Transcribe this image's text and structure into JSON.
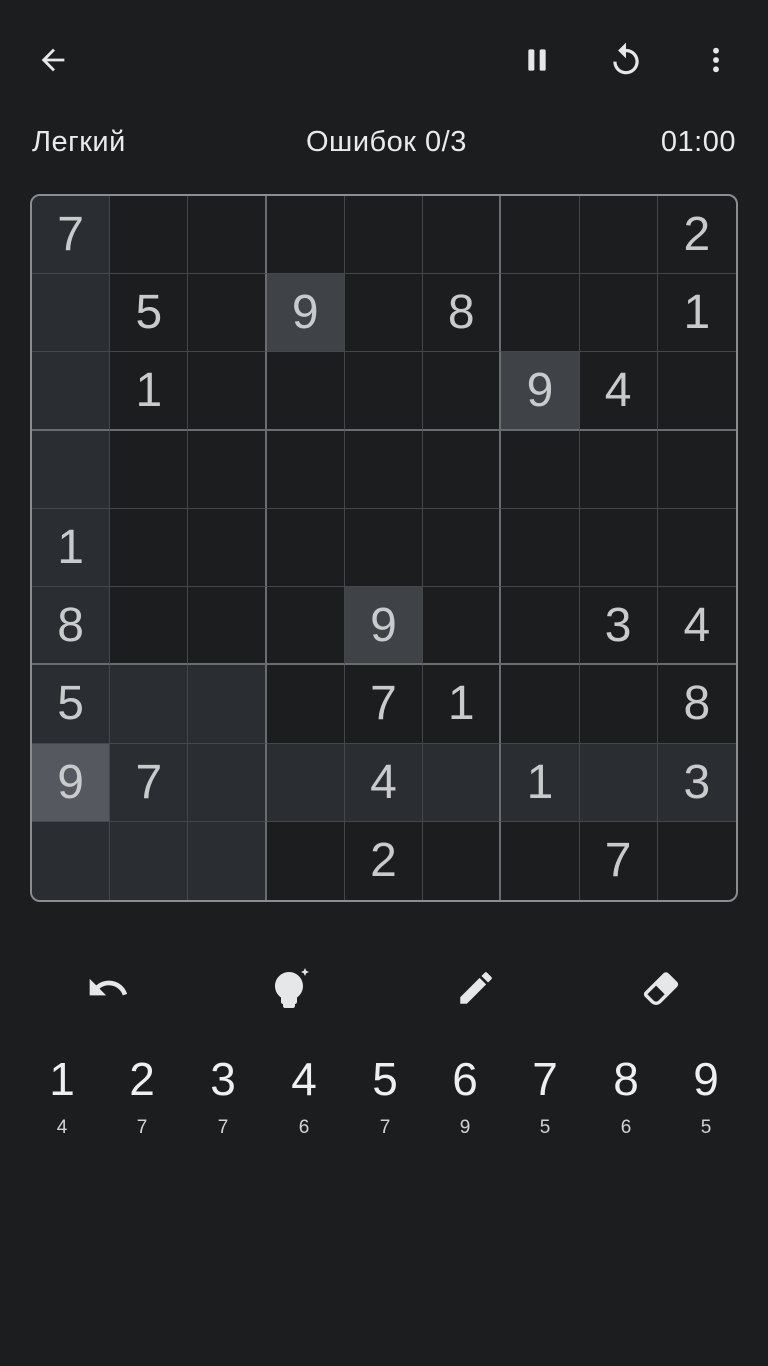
{
  "header": {
    "icons": {
      "back": "arrow-left-icon",
      "pause": "pause-icon",
      "restart": "restart-icon",
      "menu": "more-vertical-icon"
    }
  },
  "status": {
    "difficulty": "Легкий",
    "mistakes": "Ошибок 0/3",
    "timer": "01:00"
  },
  "board": {
    "rows": [
      [
        "7",
        "",
        "",
        "",
        "",
        "",
        "",
        "",
        "2"
      ],
      [
        "",
        "5",
        "",
        "9",
        "",
        "8",
        "",
        "",
        "1"
      ],
      [
        "",
        "1",
        "",
        "",
        "",
        "",
        "9",
        "4",
        ""
      ],
      [
        "",
        "",
        "",
        "",
        "",
        "",
        "",
        "",
        ""
      ],
      [
        "1",
        "",
        "",
        "",
        "",
        "",
        "",
        "",
        ""
      ],
      [
        "8",
        "",
        "",
        "",
        "9",
        "",
        "",
        "3",
        "4"
      ],
      [
        "5",
        "",
        "",
        "",
        "7",
        "1",
        "",
        "",
        "8"
      ],
      [
        "9",
        "7",
        "",
        "",
        "4",
        "",
        "1",
        "",
        "3"
      ],
      [
        "",
        "",
        "",
        "",
        "2",
        "",
        "",
        "7",
        ""
      ]
    ],
    "selected": {
      "row": 7,
      "col": 0
    },
    "same_value_cells": [
      [
        1,
        3
      ],
      [
        2,
        6
      ],
      [
        5,
        4
      ]
    ]
  },
  "tools": [
    {
      "name": "undo-icon"
    },
    {
      "name": "hint-icon"
    },
    {
      "name": "pencil-icon"
    },
    {
      "name": "eraser-icon"
    }
  ],
  "numpad": [
    {
      "digit": "1",
      "remaining": "4"
    },
    {
      "digit": "2",
      "remaining": "7"
    },
    {
      "digit": "3",
      "remaining": "7"
    },
    {
      "digit": "4",
      "remaining": "6"
    },
    {
      "digit": "5",
      "remaining": "7"
    },
    {
      "digit": "6",
      "remaining": "9"
    },
    {
      "digit": "7",
      "remaining": "5"
    },
    {
      "digit": "8",
      "remaining": "6"
    },
    {
      "digit": "9",
      "remaining": "5"
    }
  ],
  "colors": {
    "background": "#1c1d1f",
    "highlight": "#2a2d31",
    "same_value": "#3f4247",
    "selected": "#55595f"
  }
}
